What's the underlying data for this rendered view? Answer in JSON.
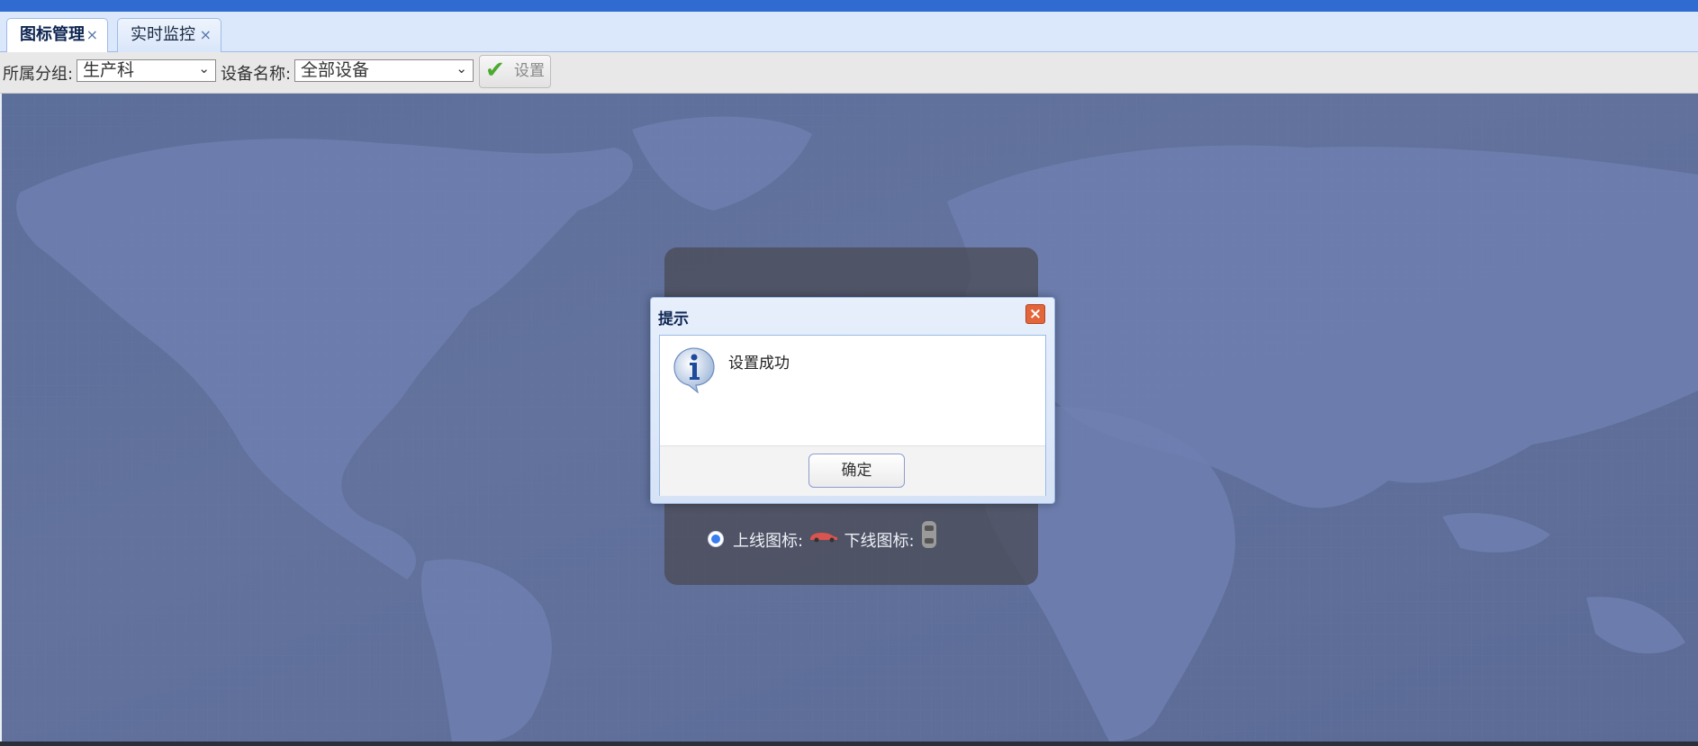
{
  "tabs": [
    {
      "label": "图标管理",
      "close": "×",
      "active": true
    },
    {
      "label": "实时监控",
      "close": "×",
      "active": false
    }
  ],
  "toolbar": {
    "group_label": "所属分组:",
    "group_value": "生产科",
    "device_label": "设备名称:",
    "device_value": "全部设备",
    "set_button": "设置"
  },
  "panel": {
    "online_label": "上线图标:",
    "offline_label": "下线图标:"
  },
  "dialog": {
    "title": "提示",
    "message": "设置成功",
    "ok_button": "确定"
  },
  "colors": {
    "topbar": "#2f6bd0",
    "map": "#5f709b",
    "accent": "#3a7df0",
    "close": "#e3663b"
  },
  "icons": [
    "close-icon",
    "chevron-down-icon",
    "check-icon",
    "info-icon",
    "car-online-icon",
    "car-offline-icon"
  ]
}
